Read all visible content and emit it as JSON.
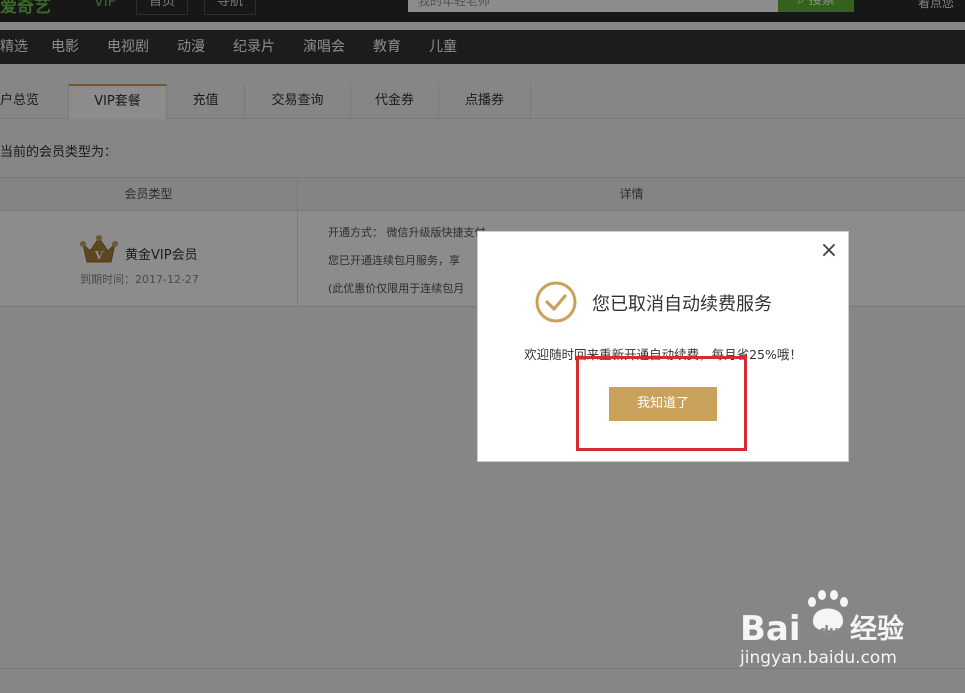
{
  "header": {
    "logo": "爱奇艺",
    "vip_tag": "VIP",
    "tabs": [
      "首页",
      "导航"
    ],
    "search_placeholder": "我的年轻老师",
    "search_button": "搜索",
    "greeting": "看点您"
  },
  "nav": [
    "精选",
    "电影",
    "电视剧",
    "动漫",
    "纪录片",
    "演唱会",
    "教育",
    "儿童"
  ],
  "account_tabs": [
    "户总览",
    "VIP套餐",
    "充值",
    "交易查询",
    "代金券",
    "点播券"
  ],
  "active_tab": "VIP套餐",
  "member_intro": "当前的会员类型为：",
  "table": {
    "headers": [
      "会员类型",
      "详情"
    ],
    "member_type": "黄金VIP会员",
    "expire": "到期时间：2017-12-27",
    "details": [
      "开通方式： 微信升级版快捷支付",
      "您已开通连续包月服务，享",
      "(此优惠价仅限用于连续包月"
    ]
  },
  "modal": {
    "title": "您已取消自动续费服务",
    "message": "欢迎随时回来重新开通自动续费，每月省25%哦！",
    "button": "我知道了",
    "close": "×"
  },
  "watermark": {
    "brand": "Bai",
    "brand2": "du",
    "brand_cn": "经验",
    "url": "jingyan.baidu.com"
  },
  "colors": {
    "accent_gold": "#c9a15a",
    "highlight_red": "#d62b30",
    "brand_green": "#6cc04a"
  }
}
